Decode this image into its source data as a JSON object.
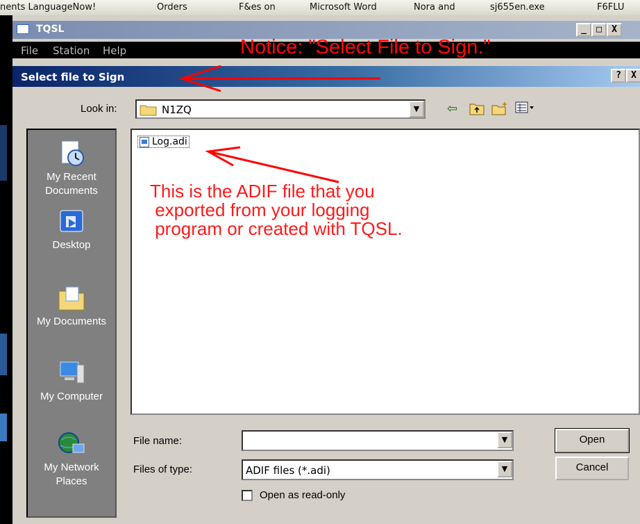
{
  "taskbar": {
    "items": [
      "nents LanguageNow!",
      "Orders",
      "F&es on",
      "Microsoft Word",
      "Nora and",
      "sj655en.exe",
      "F6FLU"
    ]
  },
  "tqsl_window": {
    "title": "TQSL",
    "menu": [
      "File",
      "Station",
      "Help"
    ],
    "caption_buttons": [
      "_",
      "□",
      "X"
    ]
  },
  "annotations": {
    "notice": "Notice: \"Select File to Sign.\"",
    "callout": "This is the ADIF file that you\n exported from your logging\n program or created with TQSL.",
    "arrow_color": "#ff0000"
  },
  "dialog": {
    "title": "Select file to Sign",
    "help_button": "?",
    "close_button": "X",
    "look_in_label": "Look in:",
    "look_in_value": "N1ZQ",
    "toolbar_icons": [
      "back-arrow-icon",
      "up-folder-icon",
      "new-folder-icon",
      "view-menu-icon"
    ],
    "places": [
      {
        "label": "My Recent\nDocuments",
        "icon": "recent-documents-icon"
      },
      {
        "label": "Desktop",
        "icon": "desktop-icon"
      },
      {
        "label": "My Documents",
        "icon": "my-documents-icon"
      },
      {
        "label": "My Computer",
        "icon": "my-computer-icon"
      },
      {
        "label": "My Network\nPlaces",
        "icon": "network-places-icon"
      }
    ],
    "files": [
      {
        "name": "Log.adi",
        "icon": "adif-file-icon"
      }
    ],
    "file_name_label": "File name:",
    "file_name_value": "",
    "files_of_type_label": "Files of type:",
    "files_of_type_value": "ADIF files (*.adi)",
    "open_button": "Open",
    "cancel_button": "Cancel",
    "read_only_label": "Open as read-only",
    "read_only_checked": false
  },
  "colors": {
    "dialog_title_start": "#0a246a",
    "dialog_title_end": "#a6caf0",
    "annotation_red": "#ff0a0a",
    "places_bar": "#808080"
  }
}
